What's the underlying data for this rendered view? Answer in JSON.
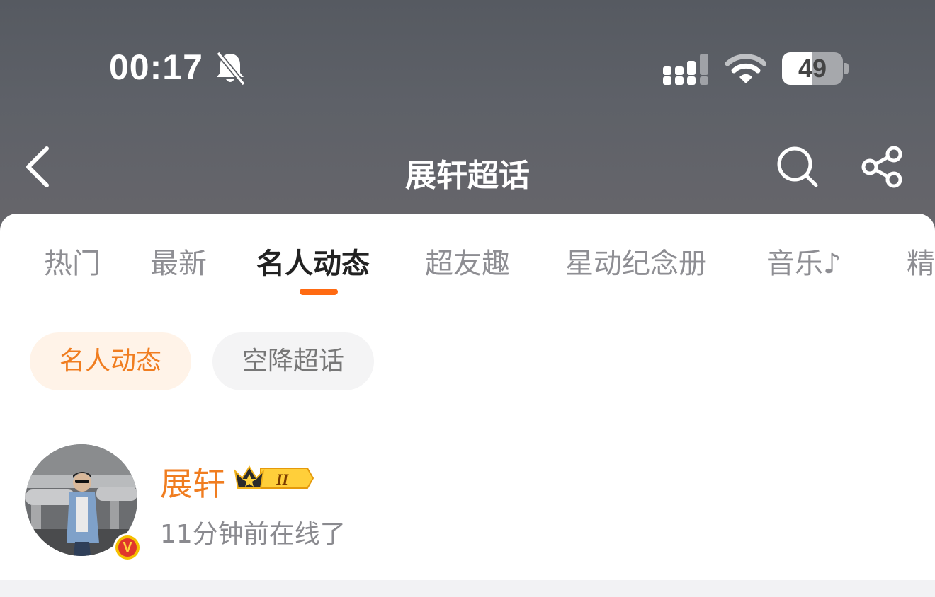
{
  "status_bar": {
    "time": "00:17",
    "battery": "49",
    "battery_level_percent": 49,
    "icons": [
      "bell-slash-icon",
      "cellular-signal-icon",
      "wifi-icon",
      "battery-icon"
    ]
  },
  "navbar": {
    "title": "展轩超话",
    "icons": [
      "back-chevron-icon",
      "search-icon",
      "share-icon"
    ]
  },
  "tabs": [
    {
      "label": "热门"
    },
    {
      "label": "最新"
    },
    {
      "label": "名人动态",
      "active": true
    },
    {
      "label": "超友趣"
    },
    {
      "label": "星动纪念册"
    },
    {
      "label": "音乐♪"
    },
    {
      "label": "精"
    }
  ],
  "sub_filters": [
    {
      "label": "名人动态",
      "active": true
    },
    {
      "label": "空降超话"
    }
  ],
  "profile": {
    "name": "展轩",
    "rank_badge": "II",
    "status": "11分钟前在线了",
    "verified_badge": "V"
  },
  "colors": {
    "accent": "#f07d20",
    "indicator": "#ff6a12",
    "header": "#5e6168"
  }
}
